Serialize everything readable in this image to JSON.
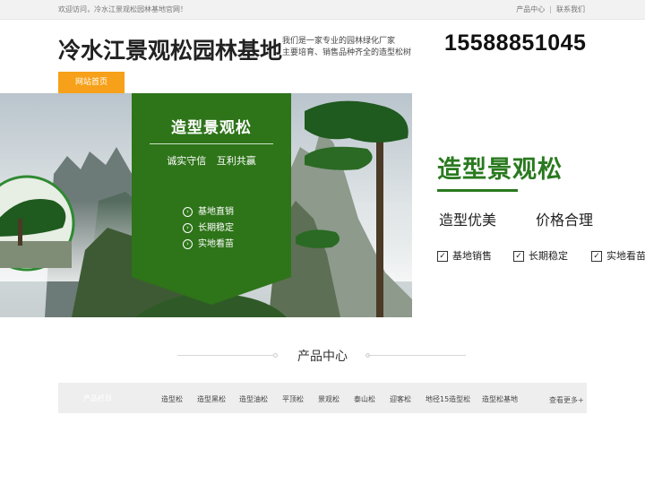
{
  "topbar": {
    "welcome": "欢迎访问，冷水江景观松园林基地官网！",
    "links": [
      "产品中心",
      "联系我们"
    ],
    "separator": "|"
  },
  "header": {
    "brand": "冷水江景观松园林基地",
    "slogan_line1": "我们是一家专业的园林绿化厂家",
    "slogan_line2": "主要培育、销售品种齐全的造型松树",
    "phone": "15588851045"
  },
  "nav": {
    "home": "网站首页"
  },
  "banner": {
    "panel": {
      "title": "造型景观松",
      "subtitle": "诚实守信 互利共赢",
      "items": [
        "基地直销",
        "长期稳定",
        "实地看苗"
      ]
    },
    "right": {
      "title": "造型景观松",
      "sub1": "造型优美",
      "sub2": "价格合理",
      "items": [
        "基地销售",
        "长期稳定",
        "实地看苗"
      ]
    },
    "colors": {
      "panel_green": "#2e7419",
      "title_green": "#2a7a1f",
      "nav_orange": "#f6a119"
    }
  },
  "products": {
    "title": "产品中心",
    "category_head": "产品栏目",
    "categories": [
      "造型松",
      "造型黑松",
      "造型油松",
      "平顶松",
      "景观松",
      "泰山松",
      "迎客松",
      "地径15造型松",
      "造型松基地"
    ],
    "more": "查看更多+"
  }
}
